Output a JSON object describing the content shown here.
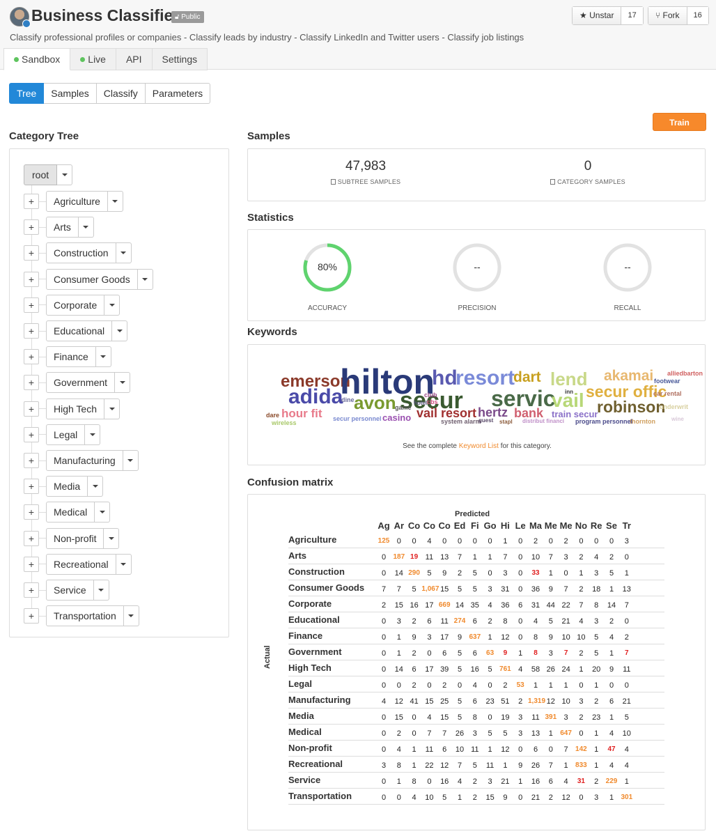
{
  "header": {
    "title": "Business Classifier",
    "badge": "Public",
    "subtitle": "Classify professional profiles or companies - Classify leads by industry - Classify LinkedIn and Twitter users - Classify job listings",
    "unstar_label": "Unstar",
    "unstar_count": "17",
    "fork_label": "Fork",
    "fork_count": "16"
  },
  "main_tabs": [
    {
      "label": "Sandbox",
      "status": "online"
    },
    {
      "label": "Live",
      "status": "online"
    },
    {
      "label": "API"
    },
    {
      "label": "Settings"
    }
  ],
  "sub_tabs": [
    "Tree",
    "Samples",
    "Classify",
    "Parameters"
  ],
  "train_label": "Train",
  "tree": {
    "title": "Category Tree",
    "root": "root",
    "categories": [
      "Agriculture",
      "Arts",
      "Construction",
      "Consumer Goods",
      "Corporate",
      "Educational",
      "Finance",
      "Government",
      "High Tech",
      "Legal",
      "Manufacturing",
      "Media",
      "Medical",
      "Non-profit",
      "Recreational",
      "Service",
      "Transportation"
    ]
  },
  "samples": {
    "title": "Samples",
    "subtree_value": "47,983",
    "subtree_label": "SUBTREE SAMPLES",
    "category_value": "0",
    "category_label": "CATEGORY SAMPLES"
  },
  "statistics": {
    "title": "Statistics",
    "accuracy": {
      "label": "ACCURACY",
      "value": "80%",
      "fraction": 0.8
    },
    "precision": {
      "label": "PRECISION",
      "value": "--"
    },
    "recall": {
      "label": "RECALL",
      "value": "--"
    }
  },
  "keywords": {
    "title": "Keywords",
    "note_prefix": "See the complete",
    "note_link": "Keyword List",
    "note_suffix": "for this category.",
    "words": [
      {
        "text": "emerson",
        "color": "#8b3a2a"
      },
      {
        "text": "hilton",
        "color": "#2a3a78"
      },
      {
        "text": "hd",
        "color": "#5a5ab0"
      },
      {
        "text": "resort",
        "color": "#7a8ad8"
      },
      {
        "text": "dart",
        "color": "#c8a020"
      },
      {
        "text": "lend",
        "color": "#c8d888"
      },
      {
        "text": "akamai",
        "color": "#e8b870"
      },
      {
        "text": "alliedbarton",
        "color": "#d06060"
      },
      {
        "text": "footwear",
        "color": "#4a5a9a"
      },
      {
        "text": "adida",
        "color": "#4a4aa8"
      },
      {
        "text": "dine",
        "color": "#6a6a9a"
      },
      {
        "text": "avon",
        "color": "#7a9a30"
      },
      {
        "text": "secur",
        "color": "#3a5a30"
      },
      {
        "text": "servic",
        "color": "#4a6a48"
      },
      {
        "text": "inn",
        "color": "#333333"
      },
      {
        "text": "vail",
        "color": "#b8d878"
      },
      {
        "text": "secur offic",
        "color": "#e0b040"
      },
      {
        "text": "car rental",
        "color": "#b07060"
      },
      {
        "text": "robinson",
        "color": "#706030"
      },
      {
        "text": "underwrit",
        "color": "#d8d0a0"
      },
      {
        "text": "club",
        "color": "#9a4a8a"
      },
      {
        "text": "hotel",
        "color": "#555577"
      },
      {
        "text": "cbs",
        "color": "#d05080"
      },
      {
        "text": "game",
        "color": "#555555"
      },
      {
        "text": "dare",
        "color": "#8a4a2a"
      },
      {
        "text": "hour fit",
        "color": "#e87a8a"
      },
      {
        "text": "vail resort",
        "color": "#a03030"
      },
      {
        "text": "hertz",
        "color": "#7a4a8a"
      },
      {
        "text": "bank",
        "color": "#d06070"
      },
      {
        "text": "train secur",
        "color": "#8a70c8"
      },
      {
        "text": "thornton",
        "color": "#d0a060"
      },
      {
        "text": "wine",
        "color": "#d8c8d8"
      },
      {
        "text": "wireless",
        "color": "#a8c868"
      },
      {
        "text": "secur personnel",
        "color": "#7a8ad0"
      },
      {
        "text": "casino",
        "color": "#9a50b0"
      },
      {
        "text": "system alarm",
        "color": "#706070"
      },
      {
        "text": "guest",
        "color": "#5a4a6a"
      },
      {
        "text": "stapl",
        "color": "#8a5a3a"
      },
      {
        "text": "distribut financi",
        "color": "#c090c8"
      },
      {
        "text": "program personnel",
        "color": "#4a4a8a"
      }
    ]
  },
  "confusion": {
    "title": "Confusion matrix",
    "predicted_label": "Predicted",
    "actual_label": "Actual",
    "columns": [
      "Ag",
      "Ar",
      "Co",
      "Co",
      "Co",
      "Ed",
      "Fi",
      "Go",
      "Hi",
      "Le",
      "Ma",
      "Me",
      "Me",
      "No",
      "Re",
      "Se",
      "Tr"
    ],
    "rows": [
      {
        "label": "Agriculture",
        "values": [
          "125",
          "0",
          "0",
          "4",
          "0",
          "0",
          "0",
          "0",
          "1",
          "0",
          "2",
          "0",
          "2",
          "0",
          "0",
          "0",
          "3"
        ]
      },
      {
        "label": "Arts",
        "values": [
          "0",
          "187",
          "19",
          "11",
          "13",
          "7",
          "1",
          "1",
          "7",
          "0",
          "10",
          "7",
          "3",
          "2",
          "4",
          "2",
          "0"
        ]
      },
      {
        "label": "Construction",
        "values": [
          "0",
          "14",
          "290",
          "5",
          "9",
          "2",
          "5",
          "0",
          "3",
          "0",
          "33",
          "1",
          "0",
          "1",
          "3",
          "5",
          "1"
        ]
      },
      {
        "label": "Consumer Goods",
        "values": [
          "7",
          "7",
          "5",
          "1,067",
          "15",
          "5",
          "5",
          "3",
          "31",
          "0",
          "36",
          "9",
          "7",
          "2",
          "18",
          "1",
          "13"
        ]
      },
      {
        "label": "Corporate",
        "values": [
          "2",
          "15",
          "16",
          "17",
          "669",
          "14",
          "35",
          "4",
          "36",
          "6",
          "31",
          "44",
          "22",
          "7",
          "8",
          "14",
          "7"
        ]
      },
      {
        "label": "Educational",
        "values": [
          "0",
          "3",
          "2",
          "6",
          "11",
          "274",
          "6",
          "2",
          "8",
          "0",
          "4",
          "5",
          "21",
          "4",
          "3",
          "2",
          "0"
        ]
      },
      {
        "label": "Finance",
        "values": [
          "0",
          "1",
          "9",
          "3",
          "17",
          "9",
          "637",
          "1",
          "12",
          "0",
          "8",
          "9",
          "10",
          "10",
          "5",
          "4",
          "2"
        ]
      },
      {
        "label": "Government",
        "values": [
          "0",
          "1",
          "2",
          "0",
          "6",
          "5",
          "6",
          "63",
          "9",
          "1",
          "8",
          "3",
          "7",
          "2",
          "5",
          "1",
          "7"
        ]
      },
      {
        "label": "High Tech",
        "values": [
          "0",
          "14",
          "6",
          "17",
          "39",
          "5",
          "16",
          "5",
          "761",
          "4",
          "58",
          "26",
          "24",
          "1",
          "20",
          "9",
          "11"
        ]
      },
      {
        "label": "Legal",
        "values": [
          "0",
          "0",
          "2",
          "0",
          "2",
          "0",
          "4",
          "0",
          "2",
          "53",
          "1",
          "1",
          "1",
          "0",
          "1",
          "0",
          "0"
        ]
      },
      {
        "label": "Manufacturing",
        "values": [
          "4",
          "12",
          "41",
          "15",
          "25",
          "5",
          "6",
          "23",
          "51",
          "2",
          "1,319",
          "12",
          "10",
          "3",
          "2",
          "6",
          "21"
        ]
      },
      {
        "label": "Media",
        "values": [
          "0",
          "15",
          "0",
          "4",
          "15",
          "5",
          "8",
          "0",
          "19",
          "3",
          "11",
          "391",
          "3",
          "2",
          "23",
          "1",
          "5"
        ]
      },
      {
        "label": "Medical",
        "values": [
          "0",
          "2",
          "0",
          "7",
          "7",
          "26",
          "3",
          "5",
          "5",
          "3",
          "13",
          "1",
          "647",
          "0",
          "1",
          "4",
          "10"
        ]
      },
      {
        "label": "Non-profit",
        "values": [
          "0",
          "4",
          "1",
          "11",
          "6",
          "10",
          "11",
          "1",
          "12",
          "0",
          "6",
          "0",
          "7",
          "142",
          "1",
          "47",
          "4"
        ]
      },
      {
        "label": "Recreational",
        "values": [
          "3",
          "8",
          "1",
          "22",
          "12",
          "7",
          "5",
          "11",
          "1",
          "9",
          "26",
          "7",
          "1",
          "833",
          "1",
          "4",
          "4"
        ]
      },
      {
        "label": "Service",
        "values": [
          "0",
          "1",
          "8",
          "0",
          "16",
          "4",
          "2",
          "3",
          "21",
          "1",
          "16",
          "6",
          "4",
          "31",
          "2",
          "229",
          "1"
        ]
      },
      {
        "label": "Transportation",
        "values": [
          "0",
          "0",
          "4",
          "10",
          "5",
          "1",
          "2",
          "15",
          "9",
          "0",
          "21",
          "2",
          "12",
          "0",
          "3",
          "1",
          "301"
        ]
      }
    ],
    "highlight_orange": [
      [
        0,
        0
      ],
      [
        1,
        1
      ],
      [
        2,
        2
      ],
      [
        3,
        3
      ],
      [
        4,
        4
      ],
      [
        5,
        5
      ],
      [
        6,
        6
      ],
      [
        7,
        7
      ],
      [
        8,
        8
      ],
      [
        9,
        9
      ],
      [
        10,
        10
      ],
      [
        11,
        11
      ],
      [
        12,
        12
      ],
      [
        13,
        13
      ],
      [
        14,
        13
      ],
      [
        15,
        15
      ],
      [
        16,
        16
      ]
    ],
    "highlight_red": [
      [
        1,
        2
      ],
      [
        2,
        10
      ],
      [
        7,
        8
      ],
      [
        7,
        10
      ],
      [
        7,
        12
      ],
      [
        7,
        16
      ],
      [
        13,
        15
      ],
      [
        15,
        13
      ]
    ]
  }
}
